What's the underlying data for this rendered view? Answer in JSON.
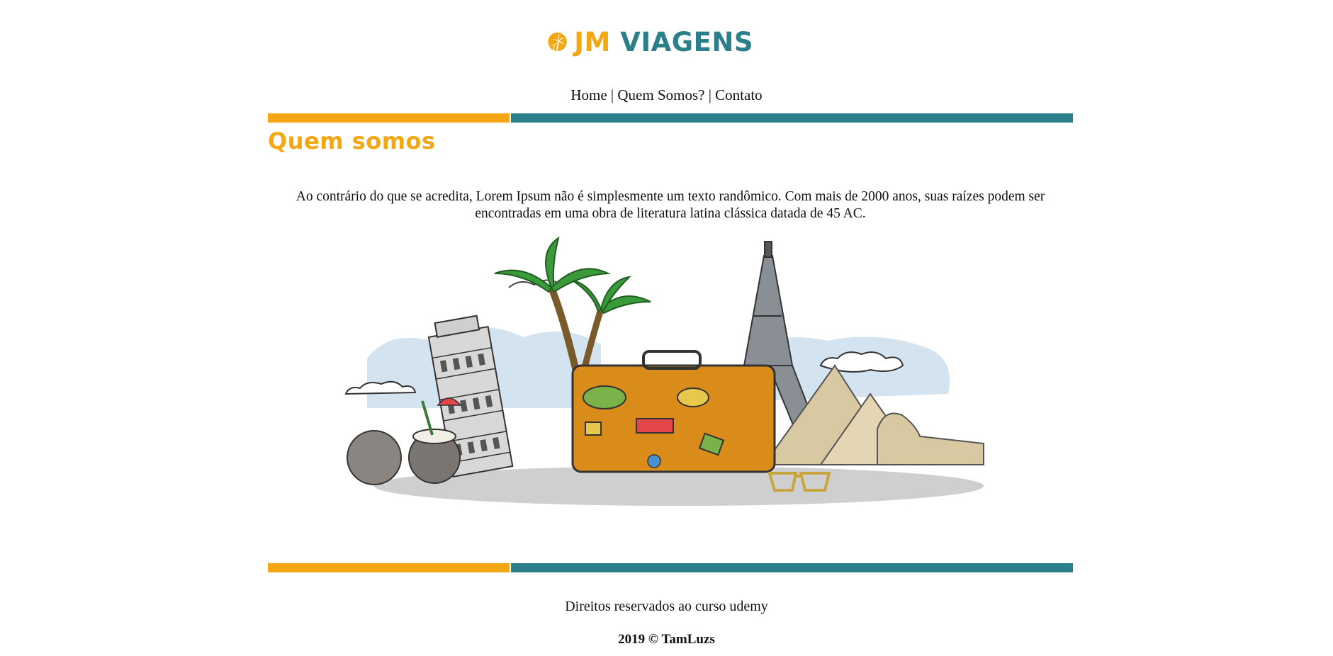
{
  "header": {
    "logo_text_jm": "JM",
    "logo_text_viagens": "VIAGENS",
    "logo_icon": "palm-sun-icon"
  },
  "nav": {
    "items": [
      "Home",
      "Quem Somos?",
      "Contato"
    ],
    "separator": "|"
  },
  "main": {
    "title": "Quem somos",
    "paragraph": "Ao contrário do que se acredita, Lorem Ipsum não é simplesmente um texto randômico. Com mais de 2000 anos, suas raízes podem ser encontradas em uma obra de literatura latina clássica datada de 45 AC.",
    "illustration": "travel-landmarks-illustration"
  },
  "footer": {
    "text": "Direitos reservados ao curso udemy",
    "copyright": "2019 © TamLuzs"
  },
  "colors": {
    "orange": "#f3a712",
    "teal": "#2a7f8a"
  }
}
